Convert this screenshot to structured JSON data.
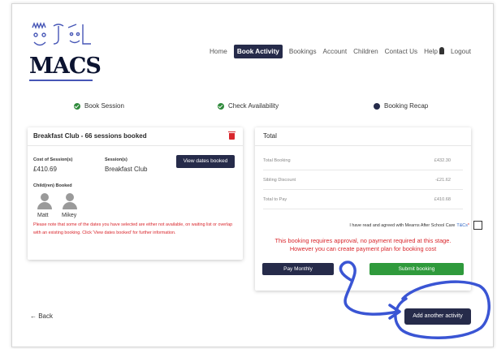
{
  "logo": {
    "word": "MACS"
  },
  "nav": {
    "items": [
      {
        "label": "Home"
      },
      {
        "label": "Book Activity",
        "active": true
      },
      {
        "label": "Bookings"
      },
      {
        "label": "Account"
      },
      {
        "label": "Children"
      },
      {
        "label": "Contact Us"
      },
      {
        "label": "Help"
      },
      {
        "label": "Logout"
      }
    ]
  },
  "steps": [
    {
      "label": "Book Session",
      "status": "done"
    },
    {
      "label": "Check Availability",
      "status": "done"
    },
    {
      "label": "Booking Recap",
      "status": "current"
    }
  ],
  "booking_card": {
    "title": "Breakfast Club - 66 sessions booked",
    "cost_label": "Cost of Session(s)",
    "cost_value": "£410.69",
    "session_label": "Session(s)",
    "session_value": "Breakfast Club",
    "view_dates_button": "View dates booked",
    "children_label": "Child(ren) Booked",
    "children": [
      {
        "name": "Matt"
      },
      {
        "name": "Mikey"
      }
    ],
    "warning": "Please note that some of the dates you have selected are either not available, on waiting list or overlap with an existing booking. Click 'View dates booked' for further information."
  },
  "total_card": {
    "title": "Total",
    "rows": [
      {
        "label": "Total Booking",
        "value": "£432.30"
      },
      {
        "label": "Sibling Discount",
        "value": "-£21.62"
      },
      {
        "label": "Total to Pay",
        "value": "£410.68"
      }
    ],
    "agree_text": "I have read and agreed with Mearns After School Care",
    "agree_link": "T&Cs",
    "agree_mark": "*",
    "approval_line1": "This booking requires approval, no payment required at this stage.",
    "approval_line2": "However you can create payment plan for booking cost",
    "pay_monthly_button": "Pay Monthly",
    "submit_button": "Submit booking"
  },
  "footer": {
    "back_label": "← Back",
    "add_activity_button": "Add another activity"
  },
  "colors": {
    "navy": "#262b4a",
    "green": "#2f9a3c",
    "red": "#d9262c",
    "annotation": "#3a55d4"
  }
}
